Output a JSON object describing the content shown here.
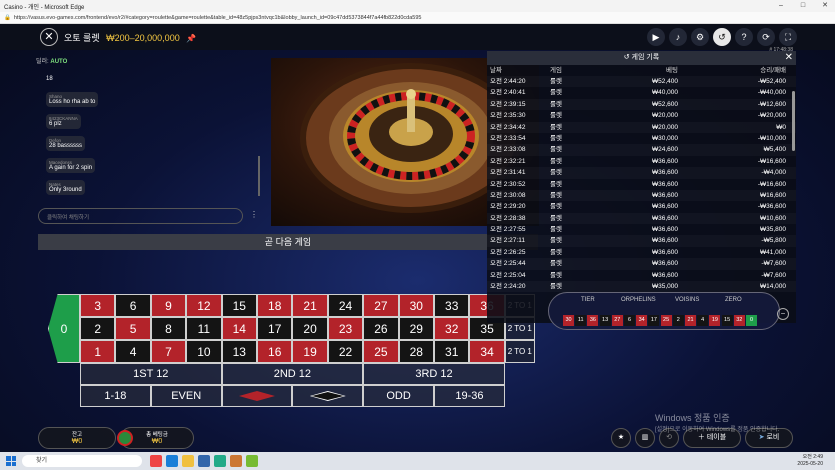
{
  "window": {
    "title": "Casino - 개인 - Microsoft Edge",
    "url": "https://vasus.evo-games.com/frontend/evo/r2/#category=roulette&game=roulette&table_id=48z5pjps3ntvqc1b&lobby_launch_id=09c47dd5373844f7a44fb822d0cda595"
  },
  "header": {
    "game_title": "오토 룰렛",
    "limits": "₩200–20,000,000",
    "time": "# 17:48:38"
  },
  "chat": {
    "auto_label": "딜러:",
    "auto_value": "AUTO",
    "messages": [
      {
        "name": "",
        "text": "18"
      },
      {
        "name": "Shano",
        "text": "Loss ho rha ab to"
      },
      {
        "name": "8423CKANNA",
        "text": "6 plz"
      },
      {
        "name": "Defon",
        "text": "28 bassssss"
      },
      {
        "name": "Macedonss",
        "text": "A gain for 2 spin"
      },
      {
        "name": "Nates",
        "text": "Only 3round"
      }
    ],
    "placeholder": "클릭하여 채팅하기"
  },
  "next_game": "곧 다음 게임",
  "board": {
    "zero": "0",
    "rows": [
      [
        {
          "n": "3",
          "c": "red"
        },
        {
          "n": "6",
          "c": "black"
        },
        {
          "n": "9",
          "c": "red"
        },
        {
          "n": "12",
          "c": "red"
        },
        {
          "n": "15",
          "c": "black"
        },
        {
          "n": "18",
          "c": "red"
        },
        {
          "n": "21",
          "c": "red"
        },
        {
          "n": "24",
          "c": "black"
        },
        {
          "n": "27",
          "c": "red"
        },
        {
          "n": "30",
          "c": "red"
        },
        {
          "n": "33",
          "c": "black"
        },
        {
          "n": "36",
          "c": "red"
        }
      ],
      [
        {
          "n": "2",
          "c": "black"
        },
        {
          "n": "5",
          "c": "red"
        },
        {
          "n": "8",
          "c": "black"
        },
        {
          "n": "11",
          "c": "black"
        },
        {
          "n": "14",
          "c": "red"
        },
        {
          "n": "17",
          "c": "black"
        },
        {
          "n": "20",
          "c": "black"
        },
        {
          "n": "23",
          "c": "red"
        },
        {
          "n": "26",
          "c": "black"
        },
        {
          "n": "29",
          "c": "black"
        },
        {
          "n": "32",
          "c": "red"
        },
        {
          "n": "35",
          "c": "black"
        }
      ],
      [
        {
          "n": "1",
          "c": "red"
        },
        {
          "n": "4",
          "c": "black"
        },
        {
          "n": "7",
          "c": "red"
        },
        {
          "n": "10",
          "c": "black"
        },
        {
          "n": "13",
          "c": "black"
        },
        {
          "n": "16",
          "c": "red"
        },
        {
          "n": "19",
          "c": "red"
        },
        {
          "n": "22",
          "c": "black"
        },
        {
          "n": "25",
          "c": "red"
        },
        {
          "n": "28",
          "c": "black"
        },
        {
          "n": "31",
          "c": "black"
        },
        {
          "n": "34",
          "c": "red"
        }
      ]
    ],
    "column_bet": "2 TO 1",
    "dozens": [
      "1ST 12",
      "2ND 12",
      "3RD 12"
    ],
    "outside": [
      "1-18",
      "EVEN",
      "",
      "",
      "ODD",
      "19-36"
    ]
  },
  "history": {
    "title": "게임 기록",
    "columns": [
      "날짜",
      "게임",
      "베팅",
      "승리/패배"
    ],
    "rows": [
      [
        "오전 2:44:20",
        "룰렛",
        "₩52,400",
        "-₩52,400"
      ],
      [
        "오전 2:40:41",
        "룰렛",
        "₩40,000",
        "-₩40,000"
      ],
      [
        "오전 2:39:15",
        "룰렛",
        "₩52,600",
        "-₩12,600"
      ],
      [
        "오전 2:35:30",
        "룰렛",
        "₩20,000",
        "-₩20,000"
      ],
      [
        "오전 2:34:42",
        "룰렛",
        "₩20,000",
        "₩0"
      ],
      [
        "오전 2:33:54",
        "룰렛",
        "₩30,000",
        "-₩10,000"
      ],
      [
        "오전 2:33:08",
        "룰렛",
        "₩24,600",
        "₩5,400"
      ],
      [
        "오전 2:32:21",
        "룰렛",
        "₩36,600",
        "-₩16,600"
      ],
      [
        "오전 2:31:41",
        "룰렛",
        "₩36,600",
        "-₩4,000"
      ],
      [
        "오전 2:30:52",
        "룰렛",
        "₩36,600",
        "-₩16,600"
      ],
      [
        "오전 2:30:08",
        "룰렛",
        "₩36,600",
        "₩16,600"
      ],
      [
        "오전 2:29:20",
        "룰렛",
        "₩36,600",
        "-₩36,600"
      ],
      [
        "오전 2:28:38",
        "룰렛",
        "₩36,600",
        "₩10,600"
      ],
      [
        "오전 2:27:55",
        "룰렛",
        "₩36,600",
        "₩35,800"
      ],
      [
        "오전 2:27:11",
        "룰렛",
        "₩36,600",
        "-₩5,800"
      ],
      [
        "오전 2:26:25",
        "룰렛",
        "₩36,600",
        "₩41,000"
      ],
      [
        "오전 2:25:44",
        "룰렛",
        "₩36,600",
        "-₩7,600"
      ],
      [
        "오전 2:25:04",
        "룰렛",
        "₩36,600",
        "-₩7,600"
      ],
      [
        "오전 2:24:20",
        "룰렛",
        "₩35,000",
        "₩14,000"
      ]
    ]
  },
  "racetrack": {
    "sections": [
      "TIER",
      "ORPHELINS",
      "VOISINS",
      "ZERO"
    ],
    "numbers": [
      {
        "n": "30",
        "c": "red"
      },
      {
        "n": "11",
        "c": "black"
      },
      {
        "n": "36",
        "c": "red"
      },
      {
        "n": "13",
        "c": "black"
      },
      {
        "n": "27",
        "c": "red"
      },
      {
        "n": "6",
        "c": "black"
      },
      {
        "n": "34",
        "c": "red"
      },
      {
        "n": "17",
        "c": "black"
      },
      {
        "n": "25",
        "c": "red"
      },
      {
        "n": "2",
        "c": "black"
      },
      {
        "n": "21",
        "c": "red"
      },
      {
        "n": "4",
        "c": "black"
      },
      {
        "n": "19",
        "c": "red"
      },
      {
        "n": "15",
        "c": "black"
      },
      {
        "n": "32",
        "c": "red"
      },
      {
        "n": "0",
        "c": "green"
      }
    ]
  },
  "bottom": {
    "balance_label": "잔고",
    "balance_value": "₩0",
    "total_bet_label": "총 베팅금",
    "total_bet_value": "₩0",
    "table_button": "테이블",
    "lobby_button": "로비"
  },
  "watermark": {
    "line1": "Windows 정품 인증",
    "line2": "[설정]으로 이동하여 Windows를 정품 인증합니다."
  },
  "taskbar": {
    "search": "찾기",
    "time": "오전 2:49",
    "date": "2025-05-20"
  }
}
